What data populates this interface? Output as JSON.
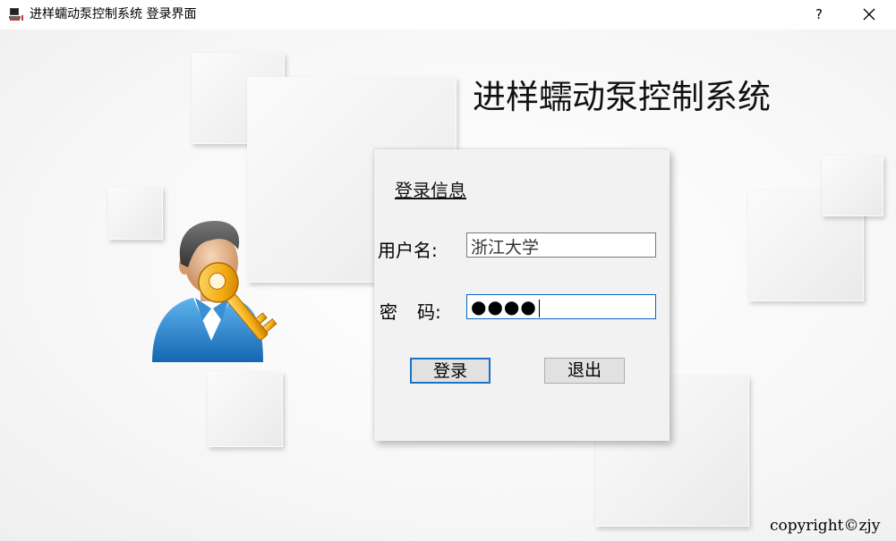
{
  "window": {
    "title": "进样蠕动泵控制系统 登录界面",
    "help_label": "?"
  },
  "app": {
    "heading": "进样蠕动泵控制系统",
    "copyright": "copyright©zjy"
  },
  "login": {
    "section_title": "登录信息",
    "username_label": "用户名:",
    "username_value": "浙江大学",
    "password_label_1": "密",
    "password_label_2": "码:",
    "password_masked": "●●●●",
    "login_button": "登录",
    "exit_button": "退出"
  },
  "icons": {
    "app": "computer-icon",
    "close": "close-icon",
    "illustration": "user-key-icon"
  },
  "colors": {
    "focus_border": "#1a73c7",
    "field_border": "#7a7a7a",
    "panel_bg": "#f2f2f2"
  }
}
